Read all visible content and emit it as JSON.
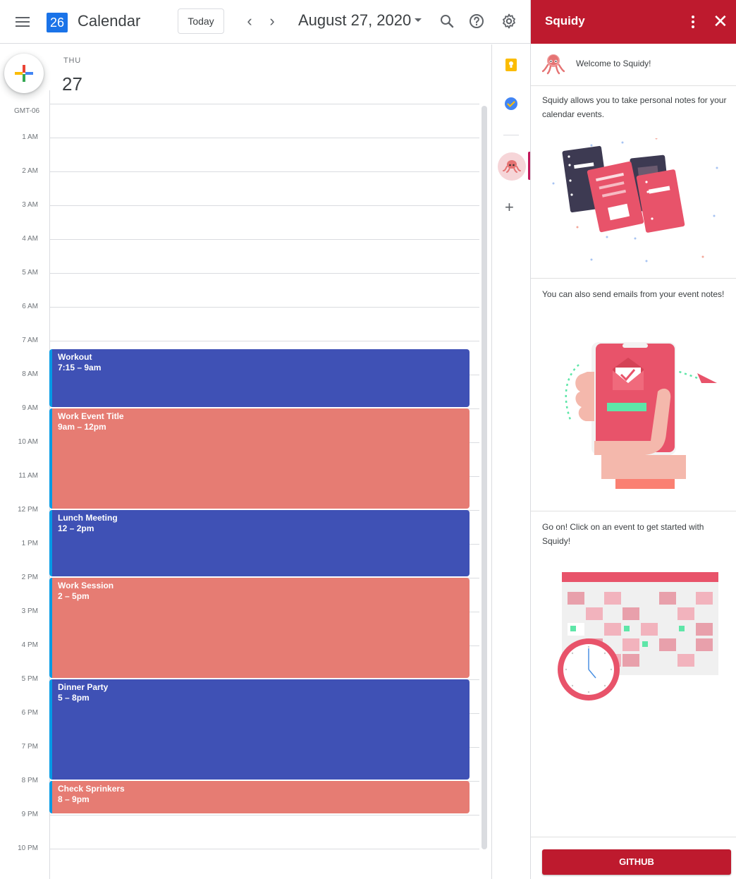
{
  "header": {
    "app_title": "Calendar",
    "logo_day": "26",
    "today_label": "Today",
    "prev_label": "‹",
    "next_label": "›",
    "date_title": "August 27, 2020"
  },
  "day": {
    "weekday": "THU",
    "number": "27",
    "timezone": "GMT-06"
  },
  "hours": [
    "1 AM",
    "2 AM",
    "3 AM",
    "4 AM",
    "5 AM",
    "6 AM",
    "7 AM",
    "8 AM",
    "9 AM",
    "10 AM",
    "11 AM",
    "12 PM",
    "1 PM",
    "2 PM",
    "3 PM",
    "4 PM",
    "5 PM",
    "6 PM",
    "7 PM",
    "8 PM",
    "9 PM",
    "10 PM"
  ],
  "events": [
    {
      "title": "Workout",
      "time": "7:15 – 9am",
      "color": "#3f51b5"
    },
    {
      "title": "Work Event Title",
      "time": "9am – 12pm",
      "color": "#e67c73"
    },
    {
      "title": "Lunch Meeting",
      "time": "12 – 2pm",
      "color": "#3f51b5"
    },
    {
      "title": "Work Session",
      "time": "2 – 5pm",
      "color": "#e67c73"
    },
    {
      "title": "Dinner Party",
      "time": "5 – 8pm",
      "color": "#3f51b5"
    },
    {
      "title": "Check Sprinkers",
      "time": "8 – 9pm",
      "color": "#e67c73"
    }
  ],
  "strip": {
    "plus_label": "+"
  },
  "panel": {
    "title": "Squidy",
    "close_label": "✕",
    "welcome": "Welcome to Squidy!",
    "intro": "Squidy allows you to take personal notes for your calendar events.",
    "email_text": "You can also send emails from your event notes!",
    "cta_text": "Go on! Click on an event to get started with Squidy!",
    "github_label": "GITHUB"
  },
  "colors": {
    "brand": "#be1a2e",
    "event_blue": "#3f51b5",
    "event_salmon": "#e67c73",
    "accent_bar": "#039be5"
  }
}
